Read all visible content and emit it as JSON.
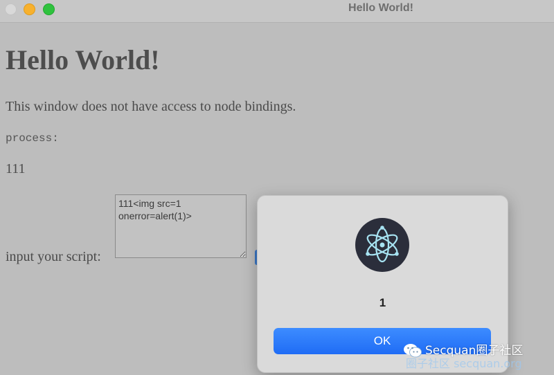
{
  "window": {
    "title": "Hello World!",
    "controls": [
      "close",
      "minimize",
      "maximize"
    ]
  },
  "page": {
    "heading": "Hello World!",
    "description": "This window does not have access to node bindings.",
    "process_label": "process:",
    "process_output": "111",
    "input_label": "input your script:",
    "script_value": "111<img src=1 onerror=alert(1)>"
  },
  "dialog": {
    "icon": "electron-atom-icon",
    "message": "1",
    "ok_label": "OK"
  },
  "watermark": {
    "icon": "wechat-icon",
    "main": "Secquan圈子社区",
    "sub": "圈子社区 secquan.org"
  },
  "colors": {
    "background": "#bdbdbd",
    "ok_button": "#1f6cf5",
    "dialog_bg": "#dadada",
    "app_icon_bg": "#2b2e3b",
    "close_light": "#d9d9d9",
    "minimize_light": "#f7b12e",
    "maximize_light": "#2fc23e"
  }
}
